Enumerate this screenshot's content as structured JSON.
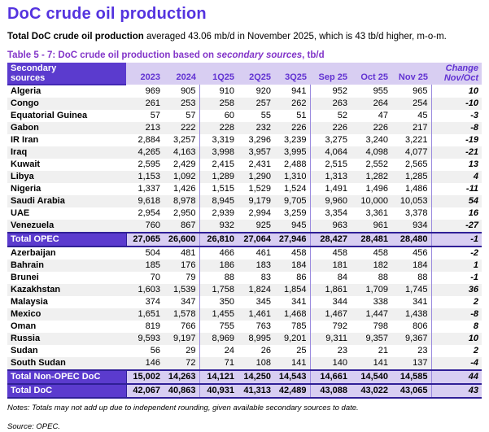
{
  "page": {
    "title": "DoC crude oil production",
    "summary_bold": "Total DoC crude oil production",
    "summary_rest": " averaged 43.06 mb/d in November 2025, which is 43 tb/d higher, m-o-m.",
    "caption_prefix": "Table 5 - 7: DoC crude oil production based on ",
    "caption_italic": "secondary sources",
    "caption_suffix": ", tb/d",
    "notes": "Notes: Totals may not add up due to independent rounding, given available secondary sources to date.",
    "source": "Source: OPEC."
  },
  "table": {
    "header": {
      "label_line1": "Secondary",
      "label_line2": "sources",
      "columns": [
        "2023",
        "2024",
        "1Q25",
        "2Q25",
        "3Q25",
        "Sep 25",
        "Oct 25",
        "Nov 25"
      ],
      "change_line1": "Change",
      "change_line2": "Nov/Oct"
    },
    "rows": [
      {
        "label": "Algeria",
        "type": "country",
        "values": [
          "969",
          "905",
          "910",
          "920",
          "941",
          "952",
          "955",
          "965"
        ],
        "change": "10"
      },
      {
        "label": "Congo",
        "type": "country",
        "values": [
          "261",
          "253",
          "258",
          "257",
          "262",
          "263",
          "264",
          "254"
        ],
        "change": "-10"
      },
      {
        "label": "Equatorial Guinea",
        "type": "country",
        "values": [
          "57",
          "57",
          "60",
          "55",
          "51",
          "52",
          "47",
          "45"
        ],
        "change": "-3"
      },
      {
        "label": "Gabon",
        "type": "country",
        "values": [
          "213",
          "222",
          "228",
          "232",
          "226",
          "226",
          "226",
          "217"
        ],
        "change": "-8"
      },
      {
        "label": "IR Iran",
        "type": "country",
        "values": [
          "2,884",
          "3,257",
          "3,319",
          "3,296",
          "3,239",
          "3,275",
          "3,240",
          "3,221"
        ],
        "change": "-19"
      },
      {
        "label": "Iraq",
        "type": "country",
        "values": [
          "4,265",
          "4,163",
          "3,998",
          "3,957",
          "3,995",
          "4,064",
          "4,098",
          "4,077"
        ],
        "change": "-21"
      },
      {
        "label": "Kuwait",
        "type": "country",
        "values": [
          "2,595",
          "2,429",
          "2,415",
          "2,431",
          "2,488",
          "2,515",
          "2,552",
          "2,565"
        ],
        "change": "13"
      },
      {
        "label": "Libya",
        "type": "country",
        "values": [
          "1,153",
          "1,092",
          "1,289",
          "1,290",
          "1,310",
          "1,313",
          "1,282",
          "1,285"
        ],
        "change": "4"
      },
      {
        "label": "Nigeria",
        "type": "country",
        "values": [
          "1,337",
          "1,426",
          "1,515",
          "1,529",
          "1,524",
          "1,491",
          "1,496",
          "1,486"
        ],
        "change": "-11"
      },
      {
        "label": "Saudi Arabia",
        "type": "country",
        "values": [
          "9,618",
          "8,978",
          "8,945",
          "9,179",
          "9,705",
          "9,960",
          "10,000",
          "10,053"
        ],
        "change": "54"
      },
      {
        "label": "UAE",
        "type": "country",
        "values": [
          "2,954",
          "2,950",
          "2,939",
          "2,994",
          "3,259",
          "3,354",
          "3,361",
          "3,378"
        ],
        "change": "16"
      },
      {
        "label": "Venezuela",
        "type": "country",
        "values": [
          "760",
          "867",
          "932",
          "925",
          "945",
          "963",
          "961",
          "934"
        ],
        "change": "-27"
      },
      {
        "label": "Total OPEC",
        "type": "total",
        "values": [
          "27,065",
          "26,600",
          "26,810",
          "27,064",
          "27,946",
          "28,427",
          "28,481",
          "28,480"
        ],
        "change": "-1"
      },
      {
        "label": "Azerbaijan",
        "type": "country",
        "values": [
          "504",
          "481",
          "466",
          "461",
          "458",
          "458",
          "458",
          "456"
        ],
        "change": "-2"
      },
      {
        "label": "Bahrain",
        "type": "country",
        "values": [
          "185",
          "176",
          "186",
          "183",
          "184",
          "181",
          "182",
          "184"
        ],
        "change": "1"
      },
      {
        "label": "Brunei",
        "type": "country",
        "values": [
          "70",
          "79",
          "88",
          "83",
          "86",
          "84",
          "88",
          "88"
        ],
        "change": "-1"
      },
      {
        "label": "Kazakhstan",
        "type": "country",
        "values": [
          "1,603",
          "1,539",
          "1,758",
          "1,824",
          "1,854",
          "1,861",
          "1,709",
          "1,745"
        ],
        "change": "36"
      },
      {
        "label": "Malaysia",
        "type": "country",
        "values": [
          "374",
          "347",
          "350",
          "345",
          "341",
          "344",
          "338",
          "341"
        ],
        "change": "2"
      },
      {
        "label": "Mexico",
        "type": "country",
        "values": [
          "1,651",
          "1,578",
          "1,455",
          "1,461",
          "1,468",
          "1,467",
          "1,447",
          "1,438"
        ],
        "change": "-8"
      },
      {
        "label": "Oman",
        "type": "country",
        "values": [
          "819",
          "766",
          "755",
          "763",
          "785",
          "792",
          "798",
          "806"
        ],
        "change": "8"
      },
      {
        "label": "Russia",
        "type": "country",
        "values": [
          "9,593",
          "9,197",
          "8,969",
          "8,995",
          "9,201",
          "9,311",
          "9,357",
          "9,367"
        ],
        "change": "10"
      },
      {
        "label": "Sudan",
        "type": "country",
        "values": [
          "56",
          "29",
          "24",
          "26",
          "25",
          "23",
          "21",
          "23"
        ],
        "change": "2"
      },
      {
        "label": "South Sudan",
        "type": "country",
        "values": [
          "146",
          "72",
          "71",
          "108",
          "141",
          "140",
          "141",
          "137"
        ],
        "change": "-4"
      },
      {
        "label": "Total Non-OPEC DoC",
        "type": "total",
        "values": [
          "15,002",
          "14,263",
          "14,121",
          "14,250",
          "14,543",
          "14,661",
          "14,540",
          "14,585"
        ],
        "change": "44"
      },
      {
        "label": "Total DoC",
        "type": "total",
        "values": [
          "42,067",
          "40,863",
          "40,931",
          "41,313",
          "42,489",
          "43,088",
          "43,022",
          "43,065"
        ],
        "change": "43"
      }
    ]
  },
  "colors": {
    "title": "#5433df",
    "caption": "#8336c9",
    "header_dark_bg": "#5b3bce",
    "header_light_bg": "#d8cef2",
    "header_text": "#6233d2",
    "total_label_bg": "#5b3bce",
    "total_row_bg": "#d8cef2",
    "dark_border": "#2f1f96",
    "group_separator": "#9a8ade",
    "stripe": "#f0f0f0"
  }
}
